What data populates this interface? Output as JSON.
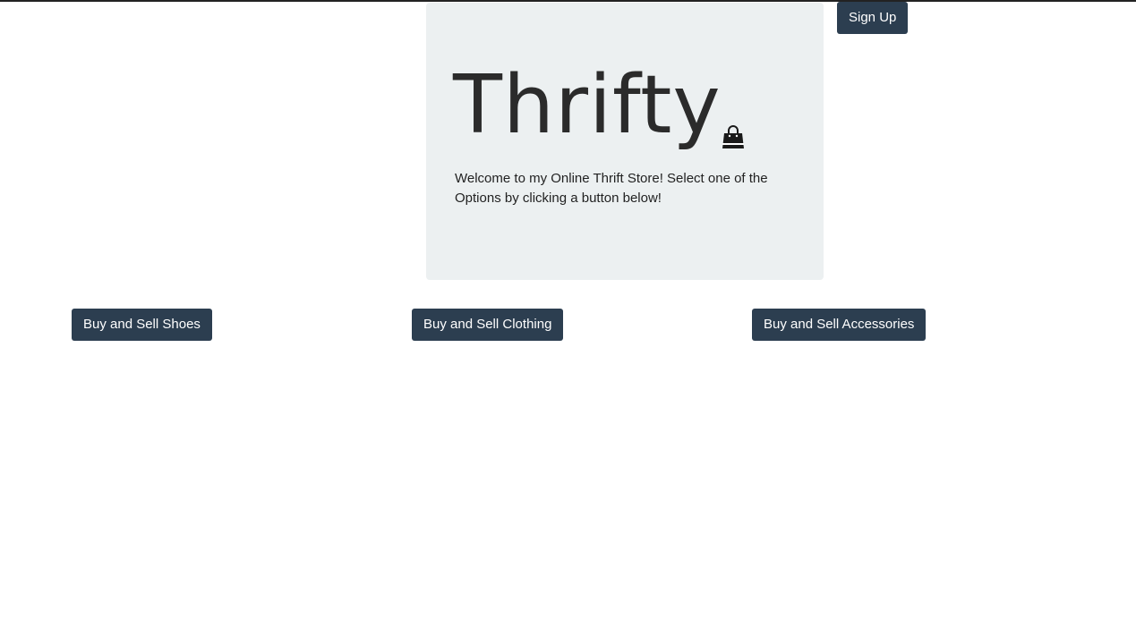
{
  "header": {
    "signup_label": "Sign Up"
  },
  "hero": {
    "title": "Thrifty",
    "icon": "shopping-bag-icon",
    "welcome_text": "Welcome to my Online Thrift Store! Select one of the Options by clicking a button below!"
  },
  "options": {
    "shoes_label": "Buy and Sell Shoes",
    "clothing_label": "Buy and Sell Clothing",
    "accessories_label": "Buy and Sell Accessories"
  },
  "colors": {
    "button_bg": "#2c3e50",
    "jumbotron_bg": "#ecf0f1"
  }
}
